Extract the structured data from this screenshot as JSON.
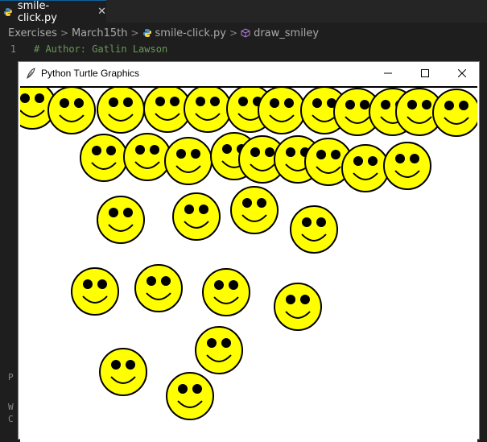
{
  "editor": {
    "tab_title": "smile-click.py",
    "breadcrumb": [
      "Exercises",
      "March15th",
      "smile-click.py",
      "draw_smiley"
    ],
    "line_number": "1",
    "code_line": "# Author: Gatlin Lawson",
    "terminal_fragments": [
      "P",
      "W",
      "C"
    ]
  },
  "turtle_window": {
    "title": "Python Turtle Graphics",
    "smiley_fill": "#ffff00",
    "smiley_stroke": "#000000"
  },
  "colors": {
    "accent": "#0e639c",
    "editor_bg": "#1e1e1e",
    "comment": "#6a9955"
  }
}
